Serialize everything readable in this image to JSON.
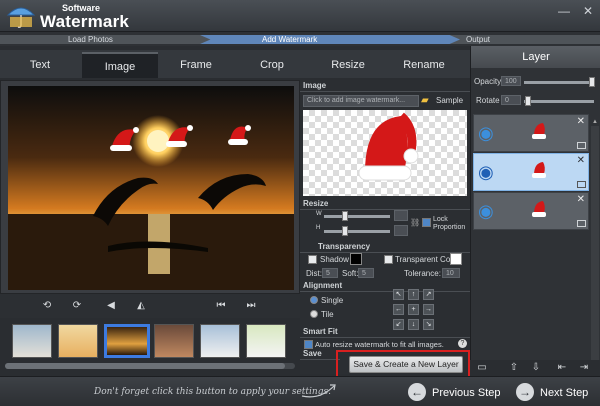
{
  "app": {
    "title_small": "Software",
    "title_large": "Watermark",
    "window_controls": [
      "—",
      "□",
      "✕"
    ]
  },
  "steps": [
    {
      "label": "Load Photos",
      "active": false
    },
    {
      "label": "Add Watermark",
      "active": true
    },
    {
      "label": "Output",
      "active": false
    }
  ],
  "tabs": [
    {
      "label": "Text",
      "active": false
    },
    {
      "label": "Image",
      "active": true
    },
    {
      "label": "Frame",
      "active": false
    },
    {
      "label": "Crop",
      "active": false
    },
    {
      "label": "Resize",
      "active": false
    },
    {
      "label": "Rename",
      "active": false
    }
  ],
  "image_section": {
    "title": "Image",
    "input_placeholder": "Click to add image watermark...",
    "folder_icon": "folder-icon",
    "sample_label": "Sample"
  },
  "resize_section": {
    "title": "Resize",
    "w_label": "W",
    "h_label": "H",
    "lock_label": "Lock Proportion",
    "lock_checked": true
  },
  "transparency_section": {
    "title": "Transparency",
    "shadow_label": "Shadow",
    "transparent_color_label": "Transparent Color",
    "dist_label": "Dist:",
    "dist_value": "5",
    "soft_label": "Soft:",
    "soft_value": "5",
    "tolerance_label": "Tolerance:",
    "tolerance_value": "10"
  },
  "alignment_section": {
    "title": "Alignment",
    "single_label": "Single",
    "tile_label": "Tile",
    "arrows": [
      "↖",
      "↑",
      "↗",
      "←",
      "+",
      "→",
      "↙",
      "↓",
      "↘"
    ]
  },
  "smartfit_section": {
    "title": "Smart Fit",
    "auto_label": "Auto resize watermark to fit all images."
  },
  "save_section": {
    "title": "Save",
    "button_label": "Save & Create a New Layer"
  },
  "layer_panel": {
    "title": "Layer",
    "opacity_label": "Opacity",
    "opacity_value": "100",
    "rotate_label": "Rotate",
    "rotate_value": "0",
    "close_glyph": "✕"
  },
  "bottom": {
    "hint": "Don't forget click this button to apply your settings.",
    "previous": "Previous Step",
    "next": "Next Step"
  },
  "colors": {
    "accent": "#5f86b9",
    "highlight": "#d92020",
    "layer_selected": "#bcd8f3"
  }
}
